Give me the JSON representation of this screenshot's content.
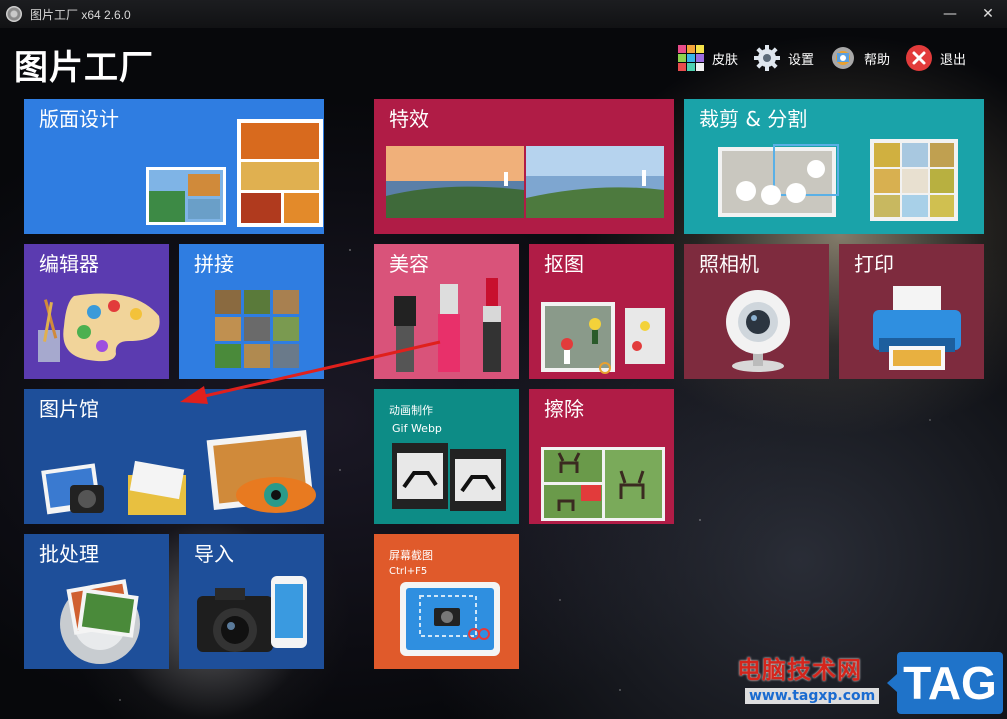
{
  "window": {
    "title": "图片工厂 x64 2.6.0",
    "controls": [
      "—",
      "✕"
    ]
  },
  "header": {
    "app_title": "图片工厂",
    "nav": [
      {
        "label": "皮肤",
        "icon": "palette-grid-icon"
      },
      {
        "label": "设置",
        "icon": "gear-icon"
      },
      {
        "label": "帮助",
        "icon": "help-gear-icon"
      },
      {
        "label": "退出",
        "icon": "close-circle-icon"
      }
    ]
  },
  "tiles": {
    "layout_design": {
      "label": "版面设计",
      "color": "#2f7de1"
    },
    "effects": {
      "label": "特效",
      "color": "#b01c46"
    },
    "crop_split": {
      "label": "裁剪 & 分割",
      "color": "#1aa3a9"
    },
    "editor": {
      "label": "编辑器",
      "color": "#5b3bb0"
    },
    "stitch": {
      "label": "拼接",
      "color": "#2f7de1"
    },
    "beauty": {
      "label": "美容",
      "color": "#d9537a"
    },
    "cutout": {
      "label": "抠图",
      "color": "#b01c46"
    },
    "camera": {
      "label": "照相机",
      "color": "#7e2b3e"
    },
    "print": {
      "label": "打印",
      "color": "#7e2b3e"
    },
    "gallery": {
      "label": "图片馆",
      "color": "#1e4f9a"
    },
    "gif": {
      "label": "动画制作",
      "sublabel": "Gif Webp",
      "color": "#0d8c86"
    },
    "erase": {
      "label": "擦除",
      "color": "#b01c46"
    },
    "batch": {
      "label": "批处理",
      "color": "#1e4f9a"
    },
    "import": {
      "label": "导入",
      "color": "#1e4f9a"
    },
    "screenshot": {
      "label": "屏幕截图",
      "sublabel": "Ctrl+F5",
      "color": "#e05a2b"
    }
  },
  "annotation": {
    "arrow_color": "#e0201c"
  },
  "watermark": {
    "text": "电脑技术网",
    "url": "www.tagxp.com",
    "tag": "TAG"
  }
}
